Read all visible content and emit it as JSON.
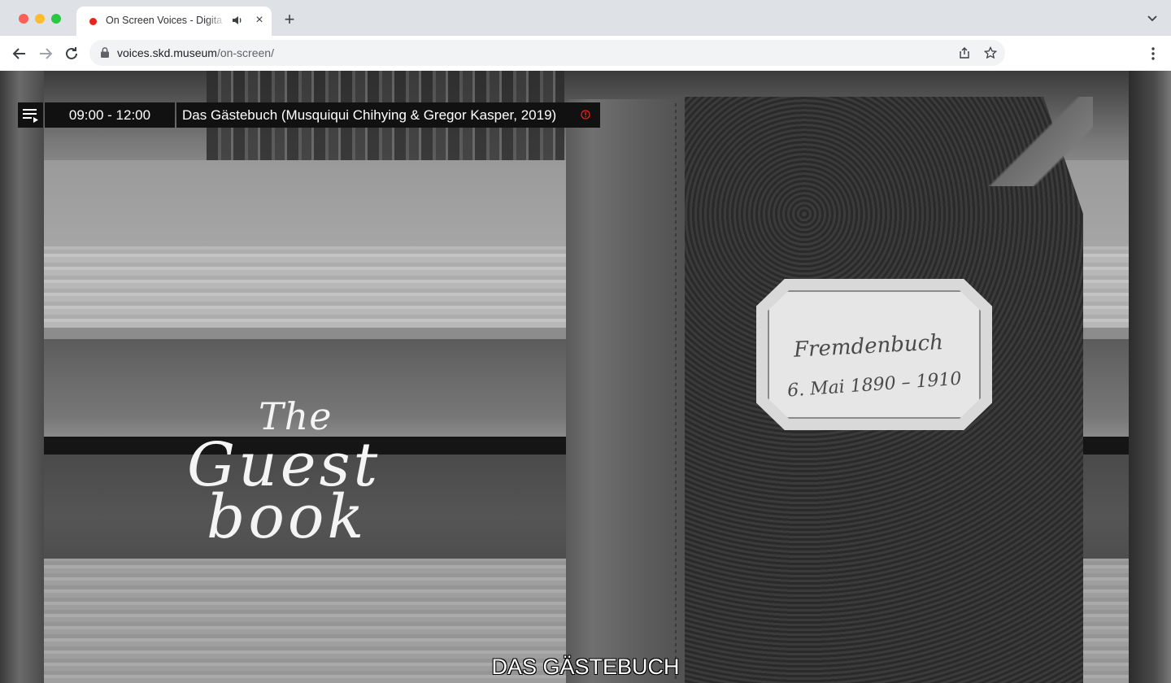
{
  "browser": {
    "tab_title": "On Screen Voices - Digital",
    "new_tab_symbol": "+",
    "close_symbol": "×",
    "url_domain": "voices.skd.museum",
    "url_path": "/on-screen/"
  },
  "schedule": {
    "time_range": "09:00 - 12:00",
    "program_title": "Das Gästebuch (Musquiqui Chihying & Gregor Kasper, 2019)"
  },
  "video": {
    "title_line1": "The",
    "title_line2": "Guest",
    "title_line3": "book",
    "label_line1": "Fremdenbuch",
    "label_line2": "6. Mai 1890 – 1910",
    "subtitle": "DAS GÄSTEBUCH"
  },
  "colors": {
    "record_dot": "#e8231b",
    "info_icon": "#e8231b"
  },
  "icons": [
    "playlist-icon",
    "info-icon",
    "lock-icon",
    "share-icon",
    "star-icon",
    "back-icon",
    "forward-icon",
    "reload-icon",
    "audio-icon",
    "kebab-menu-icon",
    "tab-search-icon"
  ]
}
